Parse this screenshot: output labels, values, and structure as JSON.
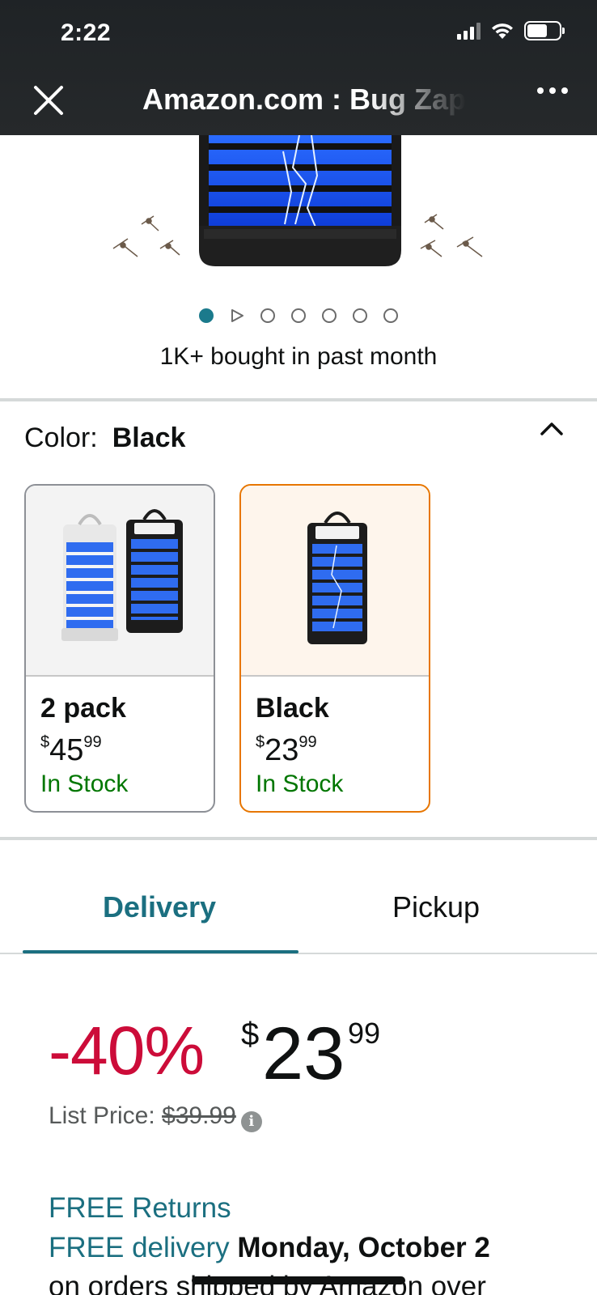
{
  "status_bar": {
    "time": "2:22"
  },
  "browser": {
    "title": "Amazon.com : Bug Zapper for Indoor"
  },
  "carousel": {
    "dot_count": 7,
    "active_index": 0
  },
  "social_proof": {
    "bought_text": "1K+ bought in past month"
  },
  "color": {
    "label": "Color:",
    "selected": "Black",
    "options": [
      {
        "name": "2 pack",
        "currency": "$",
        "whole": "45",
        "fraction": "99",
        "stock": "In Stock",
        "selected": false
      },
      {
        "name": "Black",
        "currency": "$",
        "whole": "23",
        "fraction": "99",
        "stock": "In Stock",
        "selected": true
      }
    ]
  },
  "tabs": {
    "delivery": "Delivery",
    "pickup": "Pickup"
  },
  "price": {
    "discount": "-40%",
    "currency": "$",
    "whole": "23",
    "fraction": "99",
    "list_label": "List Price:",
    "list_value": "$39.99"
  },
  "shipping": {
    "free_returns": "FREE Returns",
    "free_delivery": "FREE delivery",
    "delivery_date": "Monday, October 2",
    "orders_line": "on orders shipped by Amazon over"
  },
  "colors": {
    "accent_teal": "#1b6f80",
    "deal_red": "#cc0c39",
    "in_stock_green": "#007600",
    "selected_orange": "#e77600"
  }
}
